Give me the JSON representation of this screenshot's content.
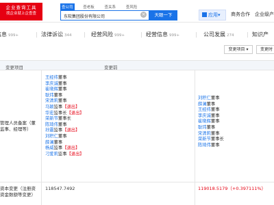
{
  "logo": {
    "line1": "企业查询工具",
    "line2": "找企业就上企查查"
  },
  "search": {
    "tabs": [
      "查公司",
      "查老板",
      "查关系",
      "查风险"
    ],
    "value": "东软集团股份有限公司",
    "clear": "×",
    "button": "天眼一下"
  },
  "nav": {
    "app": "应用",
    "app_arrow": "▾",
    "business": "商务合作",
    "enterprise": "企业级产"
  },
  "category_tabs": [
    {
      "label": "信息",
      "count": "999+"
    },
    {
      "label": "法律诉讼",
      "count": "344"
    },
    {
      "label": "经营风险",
      "count": "999+"
    },
    {
      "label": "经营信息",
      "count": "999+"
    },
    {
      "label": "公司发展",
      "count": "274"
    },
    {
      "label": "知识产",
      "count": ""
    }
  ],
  "filters": {
    "change_item": "变更项目 ▾",
    "change_time": "变更时"
  },
  "table": {
    "headers": {
      "item": "变更项目",
      "before": "变更前",
      "after": ""
    },
    "rows": [
      {
        "item_lines": [
          "管理人员备案（董",
          "监事、经理等）"
        ],
        "before": [
          {
            "name": "王经纬",
            "role": "董事",
            "tag": ""
          },
          {
            "name": "李庆诚",
            "role": "董事",
            "tag": ""
          },
          {
            "name": "崔晓辉",
            "role": "董事",
            "tag": ""
          },
          {
            "name": "耿玮",
            "role": "董事",
            "tag": ""
          },
          {
            "name": "宋清莉",
            "role": "董事",
            "tag": ""
          },
          {
            "name": "马颖",
            "role": "监事",
            "tag": "【退出】"
          },
          {
            "name": "华宏",
            "role": "监事长",
            "tag": "【退出】"
          },
          {
            "name": "荣新节",
            "role": "董事长",
            "tag": ""
          },
          {
            "name": "陈琦伟",
            "role": "董事",
            "tag": ""
          },
          {
            "name": "孙震",
            "role": "监事",
            "tag": "【退出】"
          },
          {
            "name": "刘积仁",
            "role": "董事",
            "tag": ""
          },
          {
            "name": "薛澜",
            "role": "董事",
            "tag": ""
          },
          {
            "name": "杨威",
            "role": "监事",
            "tag": "【退出】"
          },
          {
            "name": "刁爱莉",
            "role": "监事",
            "tag": "【退出】"
          }
        ],
        "after": [
          {
            "name": "刘积仁",
            "role": "董事"
          },
          {
            "name": "薛澜",
            "role": "董事"
          },
          {
            "name": "王经纬",
            "role": "董事"
          },
          {
            "name": "李庆诚",
            "role": "董事"
          },
          {
            "name": "崔晓辉",
            "role": "董事"
          },
          {
            "name": "耿玮",
            "role": "董事"
          },
          {
            "name": "宋清莉",
            "role": "董事"
          },
          {
            "name": "荣新节",
            "role": "董事长"
          },
          {
            "name": "陈琦伟",
            "role": "董事"
          }
        ]
      },
      {
        "item_lines": [
          "资本变更（注册资",
          "资金数额等变更）"
        ],
        "before_value": "118547.7492",
        "after_value": "119018.5179（+0.397111%）"
      }
    ]
  },
  "colors": {
    "brand": "#e60012",
    "link": "#1a73e8"
  }
}
